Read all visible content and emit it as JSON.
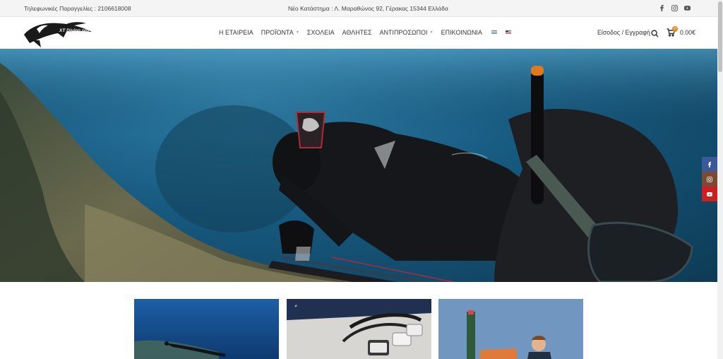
{
  "topbar": {
    "phone": "Τηλεφωνικές Παραγγελίες : 2106618008",
    "address": "Νέο Κατάστημα : Λ. Μαραθώνος 92, Γέρακας 15344 Ελλάδα",
    "social": [
      "facebook-icon",
      "instagram-icon",
      "youtube-icon"
    ]
  },
  "header": {
    "logo_text": "XT Diving pro",
    "nav": [
      {
        "label": "Η ΕΤΑΙΡΕΙΑ",
        "dropdown": false
      },
      {
        "label": "ΠΡΟΪΟΝΤΑ",
        "dropdown": true
      },
      {
        "label": "ΣΧΟΛΕΙΑ",
        "dropdown": false
      },
      {
        "label": "ΑΘΛΗΤΕΣ",
        "dropdown": false
      },
      {
        "label": "ΑΝΤΙΠΡΟΣΩΠΟΙ",
        "dropdown": true
      },
      {
        "label": "ΕΠΙΚΟΙΝΩΝΙΑ",
        "dropdown": false
      }
    ],
    "languages": [
      "greek-flag-icon",
      "english-flag-icon"
    ],
    "login": "Είσοδος / Εγγραφή",
    "cart_count": "0",
    "cart_total": "0.00€"
  },
  "hero": {
    "image": "spearfisher-underwater-photo"
  },
  "floating_social": [
    "facebook-icon",
    "instagram-icon",
    "youtube-icon"
  ],
  "cards": [
    {
      "image": "freediver-underwater-photo"
    },
    {
      "image": "speargun-products-photo"
    },
    {
      "image": "child-with-speargun-photo"
    }
  ],
  "colors": {
    "accent": "#e08a1e",
    "facebook": "#3b5998",
    "instagram": "#7a4a35",
    "youtube": "#cc1f1f"
  }
}
